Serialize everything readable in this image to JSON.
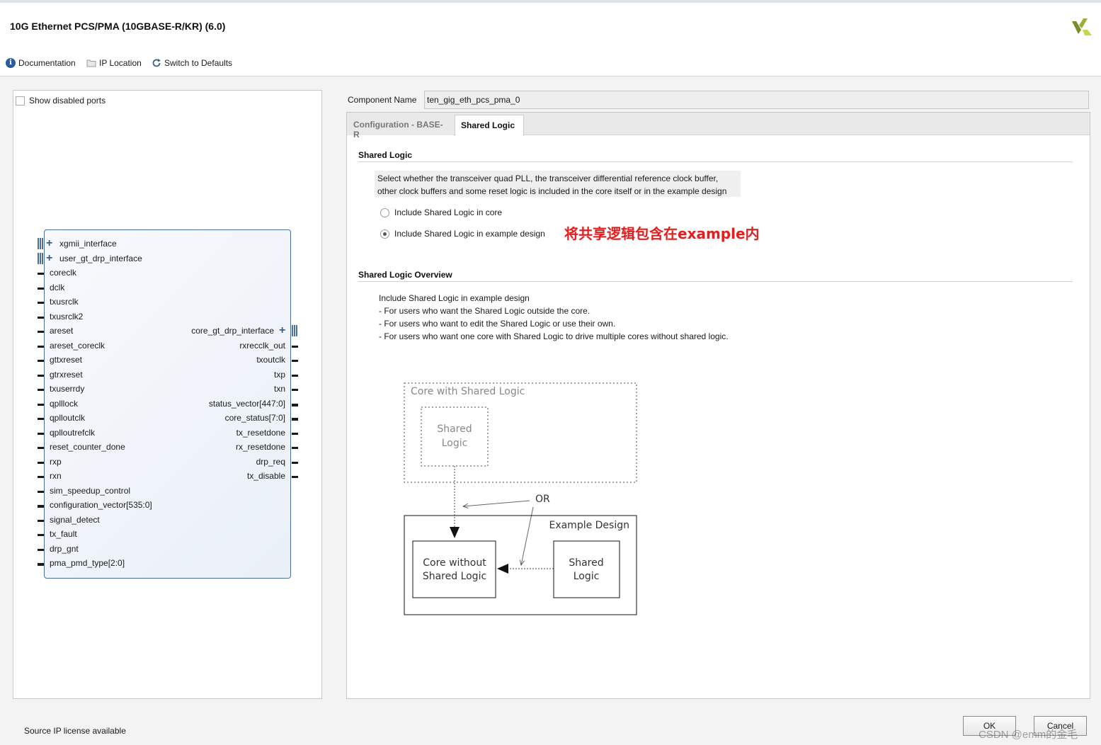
{
  "window": {
    "title": "10G Ethernet PCS/PMA (10GBASE-R/KR) (6.0)",
    "logo_icon": "xilinx-logo-icon"
  },
  "toolbar": {
    "documentation": "Documentation",
    "ip_location": "IP Location",
    "switch_defaults": "Switch to Defaults"
  },
  "left_panel": {
    "show_disabled_ports": "Show disabled ports",
    "left_ports": [
      {
        "label": "xgmii_interface",
        "kind": "bus"
      },
      {
        "label": "user_gt_drp_interface",
        "kind": "bus"
      },
      {
        "label": "coreclk",
        "kind": "pin"
      },
      {
        "label": "dclk",
        "kind": "pin"
      },
      {
        "label": "txusrclk",
        "kind": "pin"
      },
      {
        "label": "txusrclk2",
        "kind": "pin"
      },
      {
        "label": "areset",
        "kind": "pin"
      },
      {
        "label": "areset_coreclk",
        "kind": "pin"
      },
      {
        "label": "gttxreset",
        "kind": "pin"
      },
      {
        "label": "gtrxreset",
        "kind": "pin"
      },
      {
        "label": "txuserrdy",
        "kind": "pin"
      },
      {
        "label": "qplllock",
        "kind": "pin"
      },
      {
        "label": "qplloutclk",
        "kind": "pin"
      },
      {
        "label": "qplloutrefclk",
        "kind": "pin"
      },
      {
        "label": "reset_counter_done",
        "kind": "pin"
      },
      {
        "label": "rxp",
        "kind": "pin"
      },
      {
        "label": "rxn",
        "kind": "pin"
      },
      {
        "label": "sim_speedup_control",
        "kind": "pin"
      },
      {
        "label": "configuration_vector[535:0]",
        "kind": "busline"
      },
      {
        "label": "signal_detect",
        "kind": "pin"
      },
      {
        "label": "tx_fault",
        "kind": "pin"
      },
      {
        "label": "drp_gnt",
        "kind": "pin"
      },
      {
        "label": "pma_pmd_type[2:0]",
        "kind": "busline"
      }
    ],
    "right_ports": [
      {
        "label": "core_gt_drp_interface",
        "kind": "bus"
      },
      {
        "label": "rxrecclk_out",
        "kind": "pin"
      },
      {
        "label": "txoutclk",
        "kind": "pin"
      },
      {
        "label": "txp",
        "kind": "pin"
      },
      {
        "label": "txn",
        "kind": "pin"
      },
      {
        "label": "status_vector[447:0]",
        "kind": "busline"
      },
      {
        "label": "core_status[7:0]",
        "kind": "busline"
      },
      {
        "label": "tx_resetdone",
        "kind": "pin"
      },
      {
        "label": "rx_resetdone",
        "kind": "pin"
      },
      {
        "label": "drp_req",
        "kind": "pin"
      },
      {
        "label": "tx_disable",
        "kind": "pin"
      }
    ]
  },
  "component": {
    "label": "Component Name",
    "value": "ten_gig_eth_pcs_pma_0"
  },
  "tabs": [
    {
      "label": "Configuration - BASE-R",
      "active": false
    },
    {
      "label": "Shared Logic",
      "active": true
    }
  ],
  "shared_logic": {
    "heading": "Shared Logic",
    "description_line1": "Select whether the transceiver quad PLL, the transceiver differential reference clock buffer,",
    "description_line2": "other clock buffers and some reset logic is included in the core itself or in the example design",
    "options": [
      {
        "label": "Include Shared Logic in core",
        "selected": false
      },
      {
        "label": "Include Shared Logic in example design",
        "selected": true
      }
    ],
    "annotation": "将共享逻辑包含在example内",
    "annotation_color": "#e02020"
  },
  "overview": {
    "heading": "Shared Logic Overview",
    "lines": [
      "Include Shared Logic in example design",
      "- For users who want the Shared Logic outside the core.",
      "- For users who want to edit the Shared Logic or use their own.",
      "- For users who want one core with Shared Logic to drive multiple cores without shared logic."
    ],
    "diagram": {
      "core_with_shared": "Core with Shared Logic",
      "shared_logic_top": [
        "Shared",
        "Logic"
      ],
      "or_label": "OR",
      "example_design": "Example Design",
      "core_without": [
        "Core without",
        "Shared Logic"
      ],
      "shared_logic_bottom": [
        "Shared",
        "Logic"
      ]
    }
  },
  "footer": {
    "status": "Source IP license available",
    "ok": "OK",
    "cancel": "Cancel",
    "watermark": "CSDN @emm的金毛"
  }
}
